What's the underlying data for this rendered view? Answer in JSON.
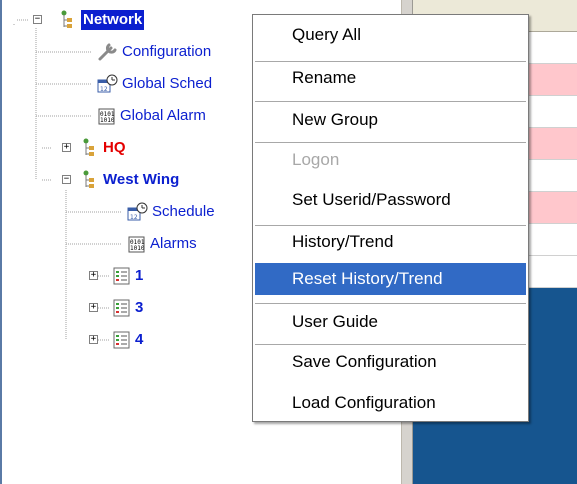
{
  "tree": {
    "nodes": [
      {
        "key": "network",
        "label": "Network",
        "icon": "network-icon"
      },
      {
        "key": "configuration",
        "label": "Configuration",
        "icon": "wrench-icon"
      },
      {
        "key": "global_schedule",
        "label": "Global Sched",
        "icon": "schedule-icon"
      },
      {
        "key": "global_alarms",
        "label": "Global Alarm",
        "icon": "alarm-icon"
      },
      {
        "key": "hq",
        "label": "HQ",
        "icon": "network-icon"
      },
      {
        "key": "west_wing",
        "label": "West Wing",
        "icon": "network-icon"
      },
      {
        "key": "schedule",
        "label": "Schedule",
        "icon": "schedule-icon"
      },
      {
        "key": "alarms",
        "label": "Alarms",
        "icon": "alarm-icon"
      },
      {
        "key": "device_1",
        "label": "1",
        "icon": "device-list-icon"
      },
      {
        "key": "device_3",
        "label": "3",
        "icon": "device-list-icon"
      },
      {
        "key": "device_4",
        "label": "4",
        "icon": "device-list-icon"
      }
    ]
  },
  "context_menu": {
    "items": [
      {
        "key": "query_all",
        "label": "Query All",
        "state": "enabled"
      },
      {
        "key": "rename",
        "label": "Rename",
        "state": "enabled"
      },
      {
        "key": "new_group",
        "label": "New Group",
        "state": "enabled"
      },
      {
        "key": "logon",
        "label": "Logon",
        "state": "disabled"
      },
      {
        "key": "set_userid",
        "label": "Set Userid/Password",
        "state": "enabled"
      },
      {
        "key": "history_trend",
        "label": "History/Trend",
        "state": "enabled"
      },
      {
        "key": "reset_history",
        "label": "Reset History/Trend",
        "state": "highlighted"
      },
      {
        "key": "user_guide",
        "label": "User Guide",
        "state": "enabled"
      },
      {
        "key": "save_config",
        "label": "Save Configuration",
        "state": "enabled"
      },
      {
        "key": "load_config",
        "label": "Load Configuration",
        "state": "enabled"
      }
    ]
  },
  "colors": {
    "tree_text": "#0b1fcf",
    "alert_text": "#e40000",
    "selection": "#0b1fcf",
    "menu_highlight": "#316ac5",
    "grid_alert_row": "#ffc7cc",
    "grid_background": "#16558f"
  }
}
